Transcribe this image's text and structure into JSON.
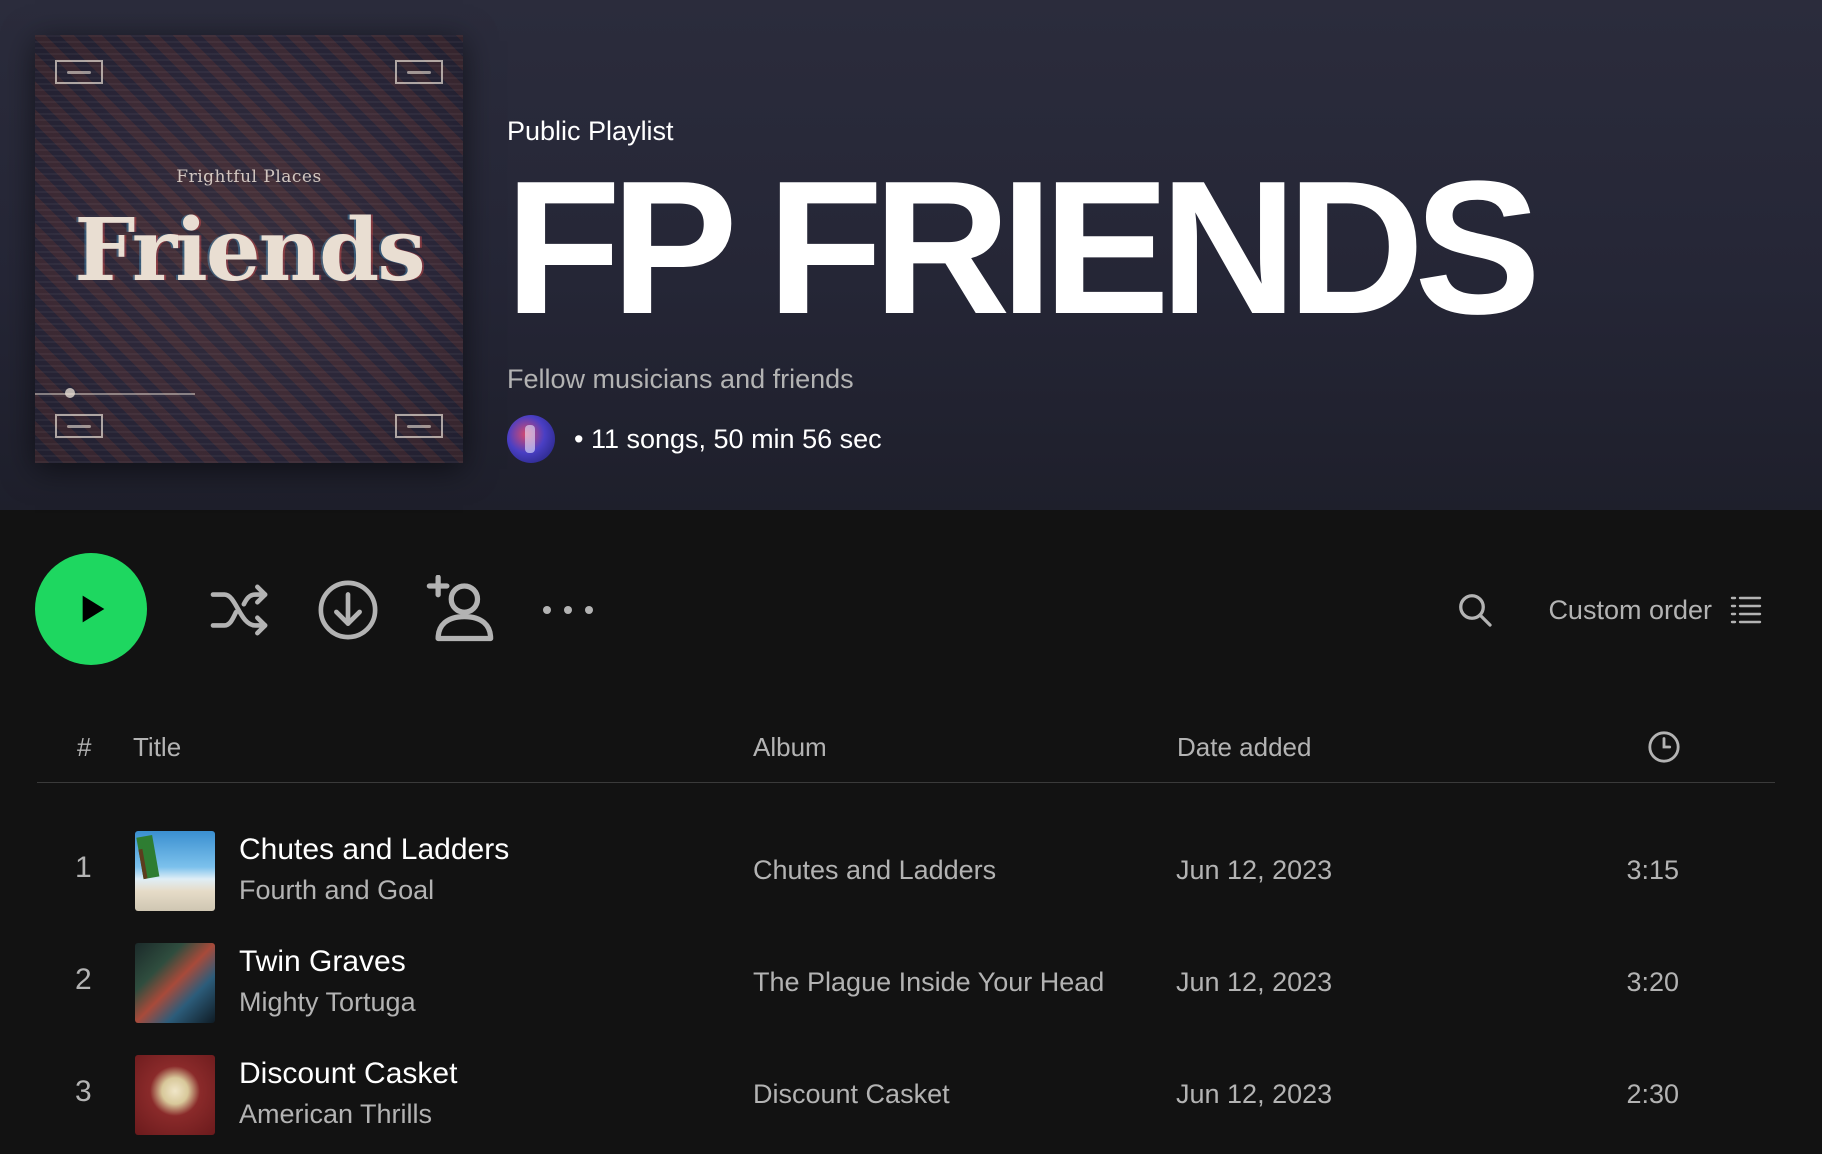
{
  "header": {
    "cover": {
      "subtitle": "Frightful Places",
      "title": "Friends"
    },
    "type_label": "Public Playlist",
    "title": "FP FRIENDS",
    "description": "Fellow musicians and friends",
    "meta": "• 11 songs, 50 min 56 sec"
  },
  "controls": {
    "play_icon": "play-icon",
    "shuffle_icon": "shuffle-icon",
    "download_icon": "download-icon",
    "add_user_icon": "add-user-icon",
    "more_icon": "more-options-icon",
    "search_icon": "search-icon",
    "sort_label": "Custom order",
    "list_icon": "list-icon"
  },
  "table": {
    "columns": {
      "number": "#",
      "title": "Title",
      "album": "Album",
      "date_added": "Date added",
      "duration_icon": "clock-icon"
    },
    "rows": [
      {
        "number": "1",
        "title": "Chutes and Ladders",
        "artist": "Fourth and Goal",
        "album": "Chutes and Ladders",
        "date_added": "Jun 12, 2023",
        "duration": "3:15"
      },
      {
        "number": "2",
        "title": "Twin Graves",
        "artist": "Mighty Tortuga",
        "album": "The Plague Inside Your Head",
        "date_added": "Jun 12, 2023",
        "duration": "3:20"
      },
      {
        "number": "3",
        "title": "Discount Casket",
        "artist": "American Thrills",
        "album": "Discount Casket",
        "date_added": "Jun 12, 2023",
        "duration": "2:30"
      }
    ]
  },
  "colors": {
    "accent": "#1ed760",
    "background": "#121212",
    "header_bg": "#2b2c3c",
    "muted_text": "#b3b3b3"
  }
}
